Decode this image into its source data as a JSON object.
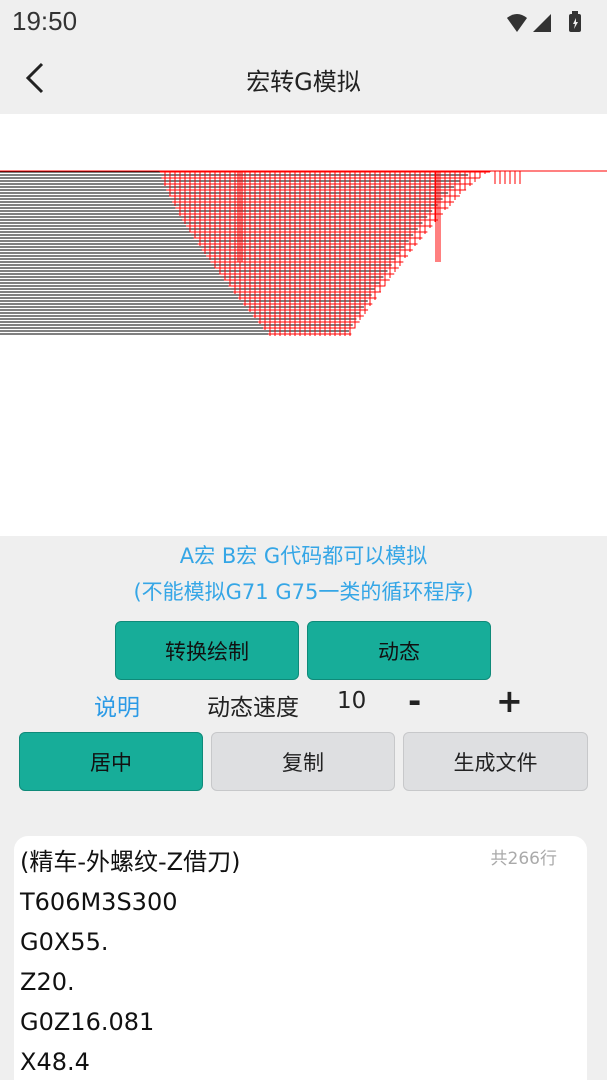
{
  "status_bar": {
    "time": "19:50",
    "icons": [
      "wifi-icon",
      "signal-icon",
      "battery-icon"
    ]
  },
  "app_bar": {
    "title": "宏转G模拟",
    "back_icon": "chevron-left-icon"
  },
  "hint": {
    "line1": "A宏 B宏 G代码都可以模拟",
    "line2": "(不能模拟G71 G75一类的循环程序)",
    "color": "#35a6e6"
  },
  "actions": {
    "convert_draw": "转换绘制",
    "animate": "动态"
  },
  "controls": {
    "help": "说明",
    "speed_label": "动态速度",
    "speed_value": "10",
    "minus": "-",
    "plus": "+"
  },
  "toolbar": {
    "center": "居中",
    "copy": "复制",
    "generate_file": "生成文件"
  },
  "code": {
    "line_count": "共266行",
    "lines": [
      "(精车-外螺纹-Z借刀)",
      "T606M3S300",
      "G0X55.",
      "Z20.",
      "G0Z16.081",
      "X48.4"
    ]
  },
  "colors": {
    "accent": "#17ad99",
    "cut_path": "#ff0000",
    "tool_path": "#000000"
  }
}
